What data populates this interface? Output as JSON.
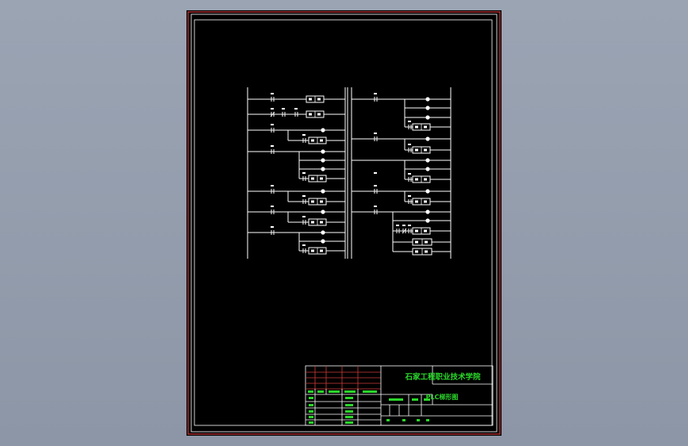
{
  "drawing": {
    "background": "#000000",
    "border_color": "#d23a3a",
    "line_color": "#ffffff",
    "text_color": "#2bd62b"
  },
  "title_block": {
    "school_name": "石家工程职业技术学院",
    "drawing_title": "PLC梯形图"
  }
}
